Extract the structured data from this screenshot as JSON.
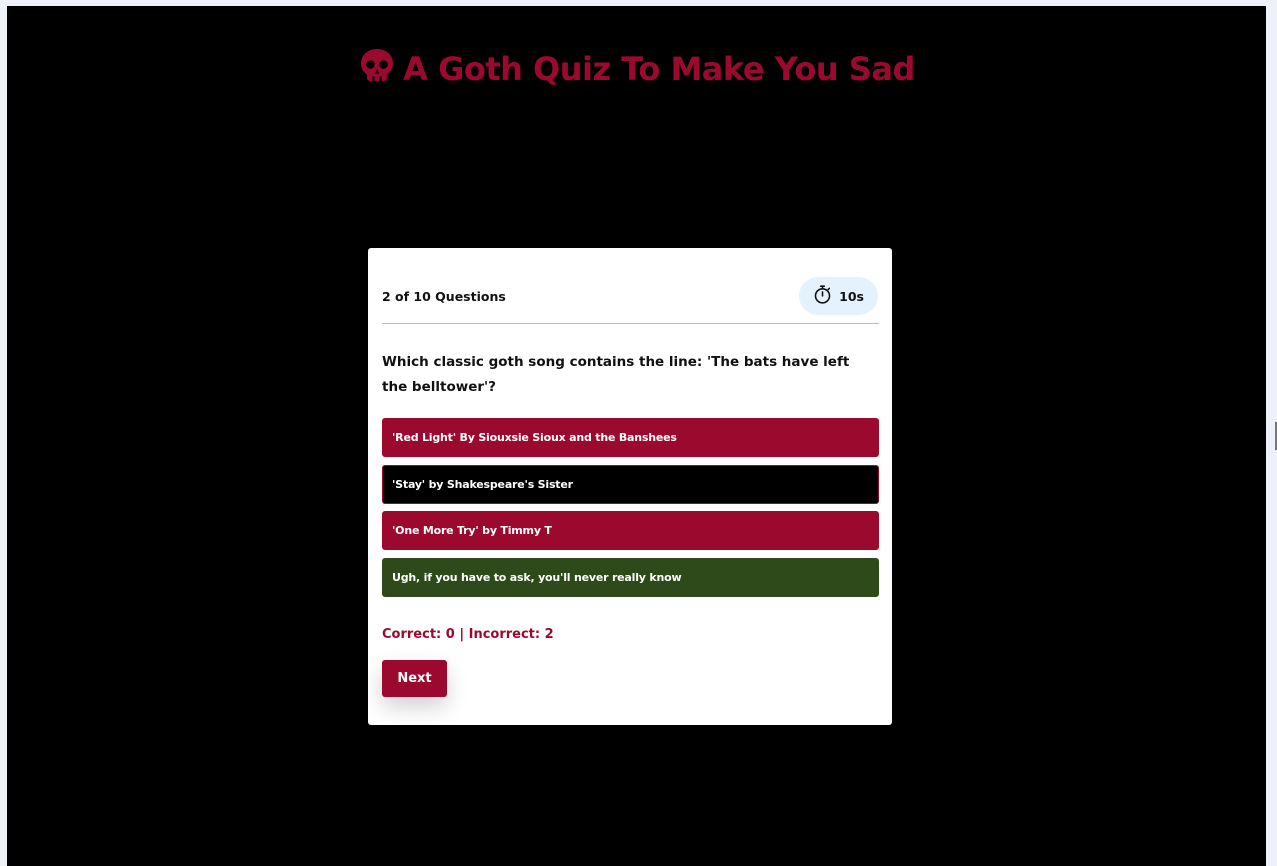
{
  "page": {
    "title": "A Goth Quiz To Make You Sad",
    "title_icon": "skull-icon",
    "accent_color": "#9b0a2e",
    "background_color": "#000000"
  },
  "quiz": {
    "progress": "2 of 10 Questions",
    "timer": {
      "icon": "stopwatch-icon",
      "value": "10s"
    },
    "question": "Which classic goth song contains the line: 'The bats have left the belltower'?",
    "options": [
      {
        "label": "'Red Light' By Siouxsie Sioux and the Banshees",
        "state": "incorrect",
        "color": "#9b0a2e"
      },
      {
        "label": "'Stay' by Shakespeare's Sister",
        "state": "default",
        "color": "#000000"
      },
      {
        "label": "'One More Try' by Timmy T",
        "state": "incorrect",
        "color": "#9b0a2e"
      },
      {
        "label": "Ugh, if you have to ask, you'll never really know",
        "state": "correct",
        "color": "#2f4a1a"
      }
    ],
    "score": "Correct: 0 | Incorrect: 2",
    "next_label": "Next"
  }
}
